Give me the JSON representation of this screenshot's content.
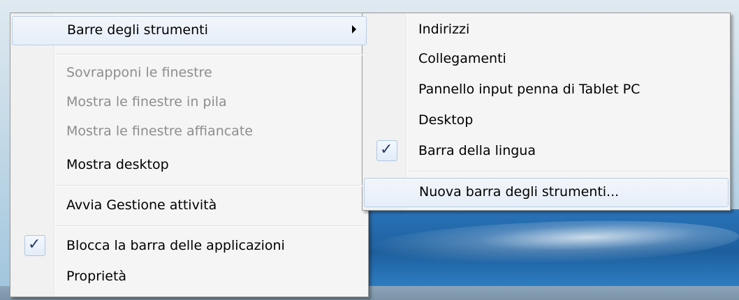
{
  "context_menu": {
    "items": [
      {
        "label": "Barre degli strumenti",
        "enabled": true,
        "submenu": true,
        "highlighted": true
      },
      {
        "label": "Sovrapponi le finestre",
        "enabled": false
      },
      {
        "label": "Mostra le finestre in pila",
        "enabled": false
      },
      {
        "label": "Mostra le finestre affiancate",
        "enabled": false
      },
      {
        "label": "Mostra desktop",
        "enabled": true
      },
      {
        "label": "Avvia Gestione attività",
        "enabled": true
      },
      {
        "label": "Blocca la barra delle applicazioni",
        "enabled": true,
        "checked": true
      },
      {
        "label": "Proprietà",
        "enabled": true
      }
    ]
  },
  "toolbars_submenu": {
    "items": [
      {
        "label": "Indirizzi",
        "checked": false
      },
      {
        "label": "Collegamenti",
        "checked": false
      },
      {
        "label": "Pannello input penna di Tablet PC",
        "checked": false
      },
      {
        "label": "Desktop",
        "checked": false
      },
      {
        "label": "Barra della lingua",
        "checked": true
      },
      {
        "label": "Nuova barra degli strumenti...",
        "highlighted": true
      }
    ]
  },
  "icons": {
    "check": "checkmark-icon",
    "submenu_arrow": "chevron-right-icon"
  },
  "colors": {
    "menu_background": "#f5f5f5",
    "disabled_text": "#8d8d8d",
    "highlight_border": "#b9cde6",
    "desktop_blue": "#1d5f9d"
  }
}
